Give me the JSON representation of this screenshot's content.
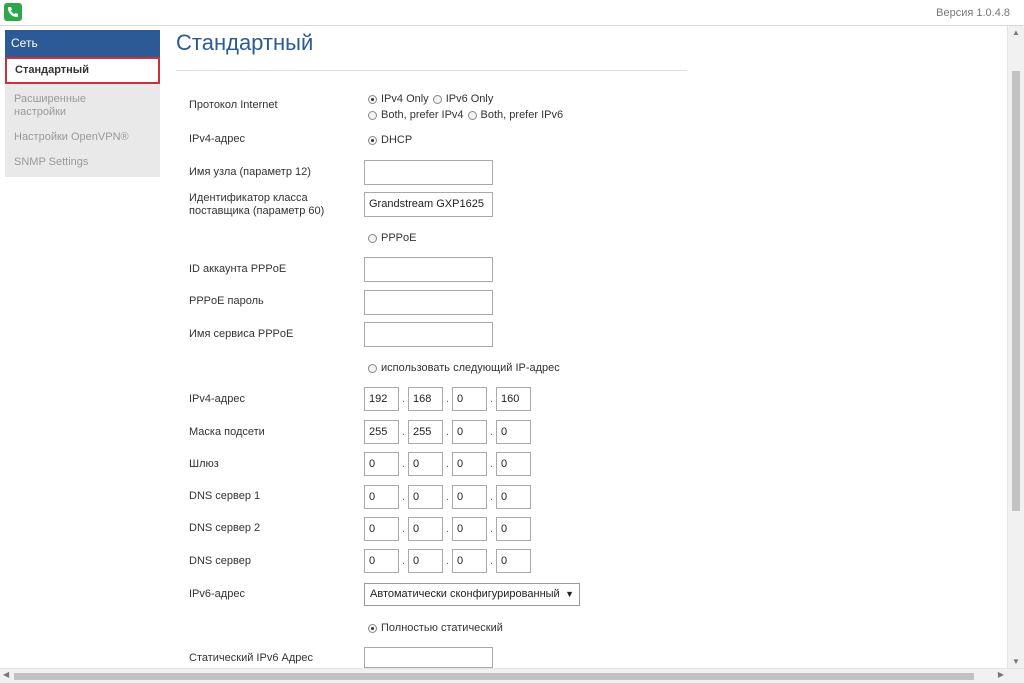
{
  "header": {
    "version": "Версия 1.0.4.8"
  },
  "sidebar": {
    "section": "Сеть",
    "items": [
      {
        "label": "Стандартный"
      },
      {
        "label": "Расширенные настройки"
      },
      {
        "label": "Настройки OpenVPN®"
      },
      {
        "label": "SNMP Settings"
      }
    ]
  },
  "page": {
    "title": "Стандартный"
  },
  "form": {
    "protocol": {
      "label": "Протокол Internet",
      "options": [
        "IPv4 Only",
        "IPv6 Only",
        "Both, prefer IPv4",
        "Both, prefer IPv6"
      ],
      "selected": "IPv4 Only"
    },
    "ipv4_mode_label": "IPv4-адрес",
    "dhcp_label": "DHCP",
    "hostname": {
      "label": "Имя узла (параметр 12)",
      "value": ""
    },
    "vendor_class": {
      "label": "Идентификатор класса поставщика (параметр 60)",
      "value": "Grandstream GXP1625"
    },
    "pppoe_label": "PPPoE",
    "pppoe_account": {
      "label": "ID аккаунта PPPoE",
      "value": ""
    },
    "pppoe_password": {
      "label": "PPPoE пароль",
      "value": ""
    },
    "pppoe_service": {
      "label": "Имя сервиса PPPoE",
      "value": ""
    },
    "static_label": "использовать следующий IP-адрес",
    "ip_rows": [
      {
        "label": "IPv4-адрес",
        "octets": [
          "192",
          "168",
          "0",
          "160"
        ]
      },
      {
        "label": "Маска подсети",
        "octets": [
          "255",
          "255",
          "0",
          "0"
        ]
      },
      {
        "label": "Шлюз",
        "octets": [
          "0",
          "0",
          "0",
          "0"
        ]
      },
      {
        "label": "DNS сервер 1",
        "octets": [
          "0",
          "0",
          "0",
          "0"
        ]
      },
      {
        "label": "DNS сервер 2",
        "octets": [
          "0",
          "0",
          "0",
          "0"
        ]
      },
      {
        "label": "DNS сервер",
        "octets": [
          "0",
          "0",
          "0",
          "0"
        ]
      }
    ],
    "ipv6": {
      "label": "IPv6-адрес",
      "selected": "Автоматически сконфигурированный"
    },
    "full_static_label": "Полностью статический",
    "static_ipv6": {
      "label": "Статический IPv6 Адрес",
      "value": ""
    }
  },
  "colors": {
    "accent": "#2c5a97",
    "highlight": "#c9323b",
    "logo": "#2aa84a"
  }
}
